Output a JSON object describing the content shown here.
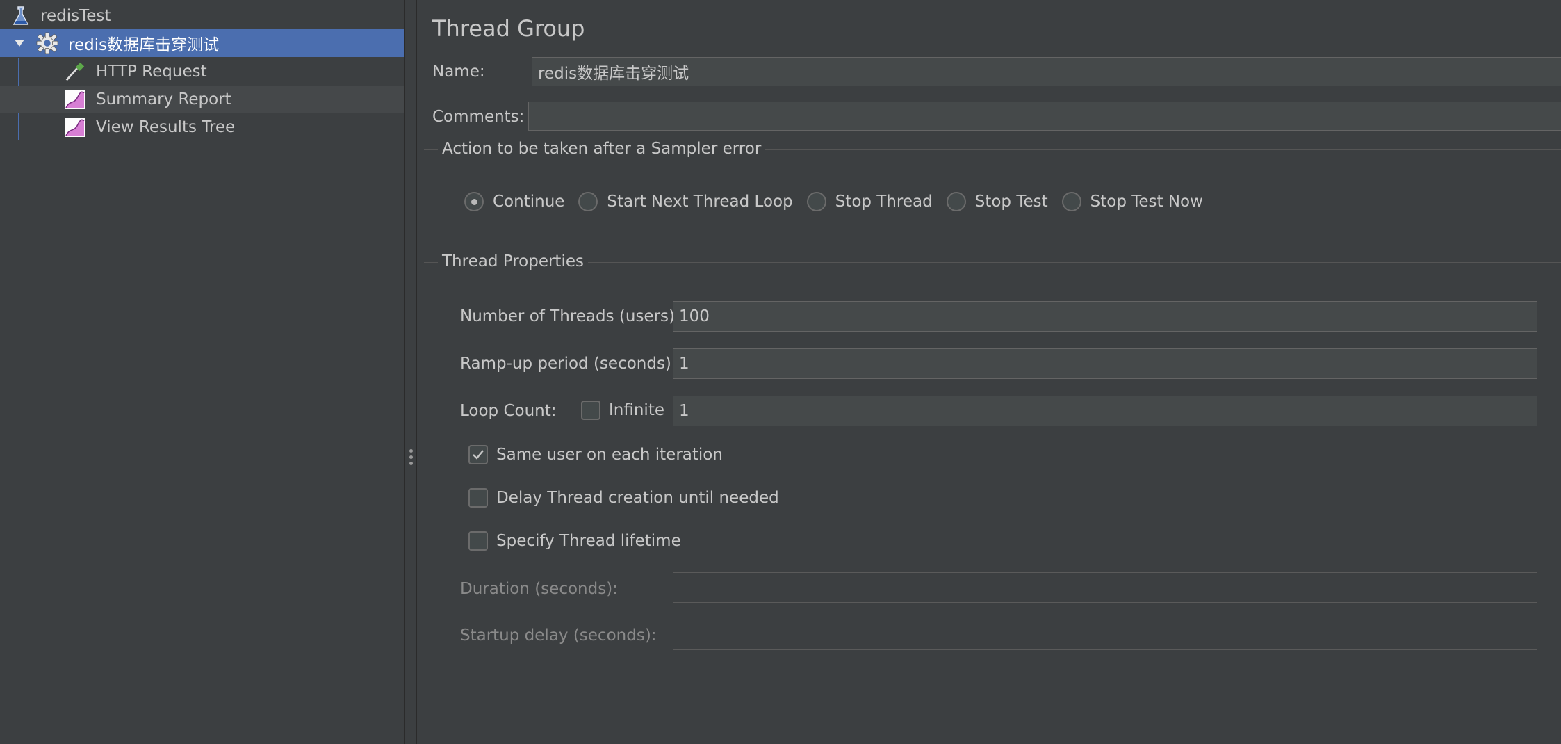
{
  "tree": {
    "items": [
      {
        "label": "redisTest",
        "icon": "test-plan-flask-icon"
      },
      {
        "label": "redis数据库击穿测试",
        "icon": "thread-group-gear-icon"
      },
      {
        "label": "HTTP Request",
        "icon": "sampler-pipette-icon"
      },
      {
        "label": "Summary Report",
        "icon": "listener-graph-icon"
      },
      {
        "label": "View Results Tree",
        "icon": "listener-graph-icon"
      }
    ],
    "selected_color": "#4b6eaf"
  },
  "panel": {
    "title": "Thread Group",
    "name_label": "Name:",
    "name_value": "redis数据库击穿测试",
    "comments_label": "Comments:",
    "comments_value": ""
  },
  "sampler_error": {
    "title": "Action to be taken after a Sampler error",
    "options": [
      "Continue",
      "Start Next Thread Loop",
      "Stop Thread",
      "Stop Test",
      "Stop Test Now"
    ],
    "selected": "Continue"
  },
  "thread_properties": {
    "title": "Thread Properties",
    "threads_label": "Number of Threads (users):",
    "threads_value": "100",
    "rampup_label": "Ramp-up period (seconds):",
    "rampup_value": "1",
    "loop_label": "Loop Count:",
    "infinite_label": "Infinite",
    "infinite_checked": false,
    "loop_value": "1",
    "same_user_label": "Same user on each iteration",
    "same_user_checked": true,
    "delay_label": "Delay Thread creation until needed",
    "delay_checked": false,
    "lifetime_label": "Specify Thread lifetime",
    "lifetime_checked": false,
    "duration_label": "Duration (seconds):",
    "duration_value": "",
    "startup_label": "Startup delay (seconds):",
    "startup_value": ""
  }
}
